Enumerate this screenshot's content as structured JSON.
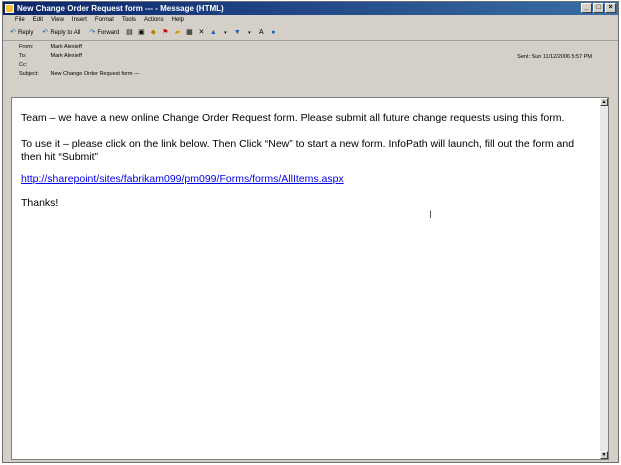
{
  "window": {
    "title": "New Change Order Request form --- - Message (HTML)"
  },
  "menu": [
    "File",
    "Edit",
    "View",
    "Insert",
    "Format",
    "Tools",
    "Actions",
    "Help"
  ],
  "toolbar": {
    "reply": "Reply",
    "reply_all": "Reply to All",
    "forward": "Forward"
  },
  "header": {
    "from_label": "From:",
    "from_value": "Mark Alexieff",
    "to_label": "To:",
    "to_value": "Mark Alexieff",
    "cc_label": "Cc:",
    "cc_value": "",
    "subject_label": "Subject:",
    "subject_value": "New Change Order Request form ---",
    "sent_label": "Sent:",
    "sent_value": "Sun 11/12/2006 5:57 PM"
  },
  "message": {
    "line1": "Team – we have a new online Change Order Request form.  Please submit all future change requests using this form.",
    "line2a": "To use it – please click on the link below.  Then Click “New” to start a new form.  InfoPath will launch, fill out the form and",
    "line2b": "then hit “Submit”",
    "link": "http://sharepoint/sites/fabrikam099/pm099/Forms/forms/AllItems.aspx",
    "closing": "Thanks!"
  },
  "colors": {
    "title_start": "#0a246a",
    "title_end": "#3a6ea5",
    "link": "#0000ee"
  }
}
